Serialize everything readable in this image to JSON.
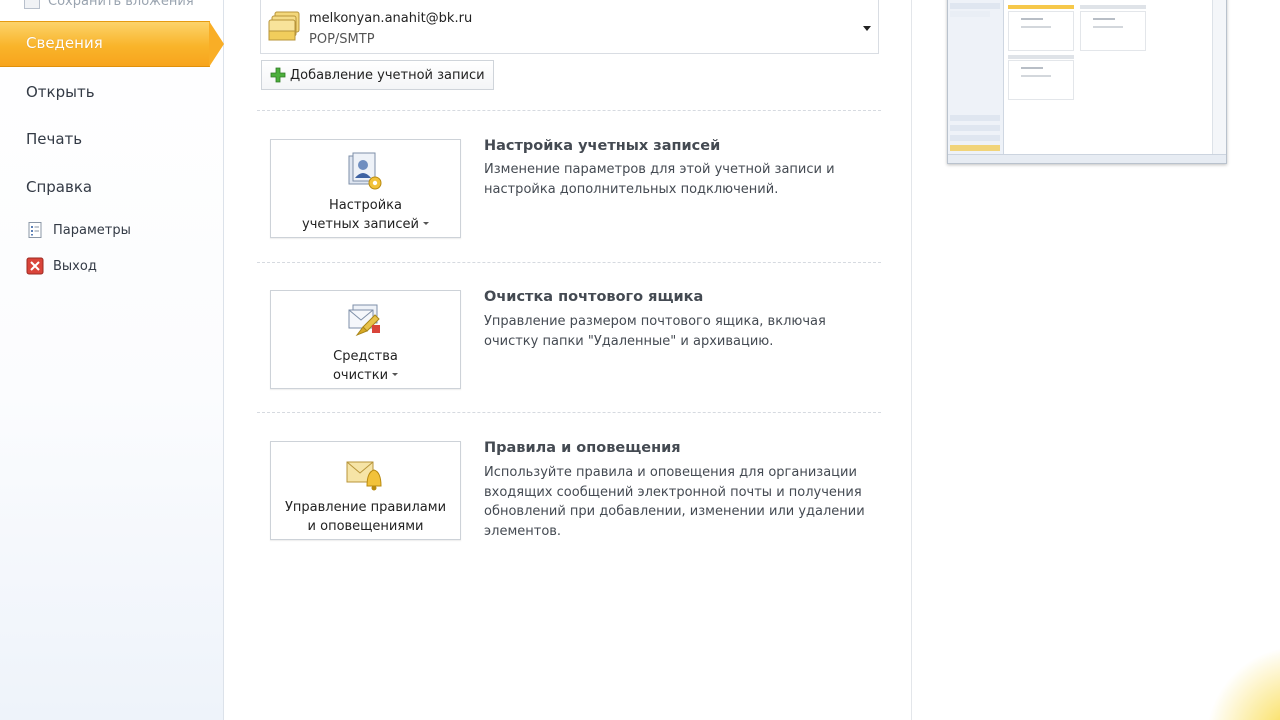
{
  "nav": {
    "top_partial": "Сохранить вложения",
    "selected": "Сведения",
    "items": [
      "Открыть",
      "Печать",
      "Справка"
    ],
    "small_items": [
      "Параметры",
      "Выход"
    ]
  },
  "account": {
    "email": "melkonyan.anahit@bk.ru",
    "protocol": "POP/SMTP",
    "add_label": "Добавление учетной записи"
  },
  "sections": [
    {
      "button_lines": [
        "Настройка",
        "учетных записей"
      ],
      "has_dropdown": true,
      "title": "Настройка учетных записей",
      "desc": "Изменение параметров для этой учетной записи и настройка дополнительных подключений.",
      "icon": "account-settings-icon"
    },
    {
      "button_lines": [
        "Средства",
        "очистки"
      ],
      "has_dropdown": true,
      "title": "Очистка почтового ящика",
      "desc": "Управление размером почтового ящика, включая очистку папки \"Удаленные\" и архивацию.",
      "icon": "cleanup-tools-icon"
    },
    {
      "button_lines": [
        "Управление правилами",
        "и оповещениями"
      ],
      "has_dropdown": false,
      "title": "Правила и оповещения",
      "desc": "Используйте правила и оповещения для организации входящих сообщений электронной почты и получения обновлений при добавлении, изменении или удалении элементов.",
      "icon": "rules-alerts-icon"
    }
  ],
  "colors": {
    "accent": "#f9b42a",
    "text": "#333a45"
  }
}
